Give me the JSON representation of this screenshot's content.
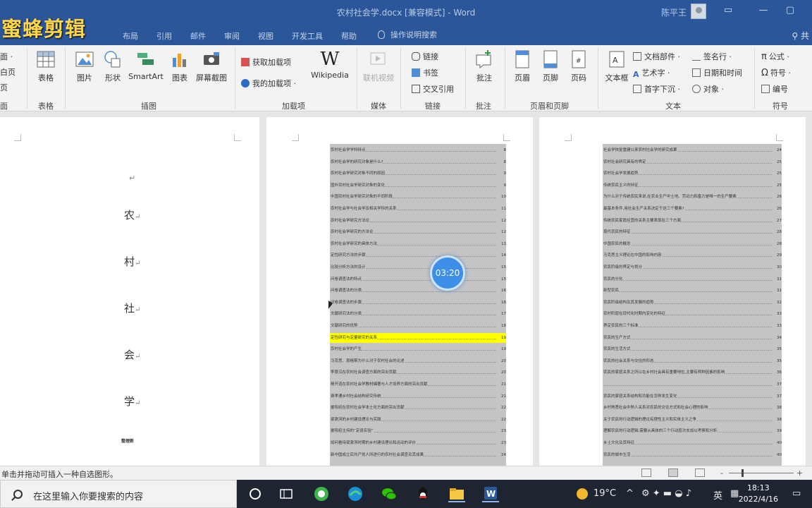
{
  "watermark": "蜜蜂剪辑",
  "titlebar": {
    "doc_title": "农村社会学.docx [兼容模式] - Word",
    "user_name": "陈平王"
  },
  "tabs": [
    "布局",
    "引用",
    "邮件",
    "审阅",
    "视图",
    "开发工具",
    "帮助"
  ],
  "tell_me": "操作说明搜索",
  "share": "共",
  "ribbon": {
    "left_partial": [
      "面 ·",
      "白页",
      "页",
      "面"
    ],
    "table": "表格",
    "illustrations": [
      "图片",
      "形状",
      "SmartArt",
      "图表",
      "屏幕截图"
    ],
    "addins": [
      "获取加载项",
      "我的加载项"
    ],
    "wikipedia": "Wikipedia",
    "media_btn": "联机视频",
    "links": [
      "链接",
      "书签",
      "交叉引用"
    ],
    "comment_btn": "批注",
    "header_footer": [
      "页眉",
      "页脚",
      "页码"
    ],
    "textbox": "文本框",
    "text_small": [
      "文档部件 ·",
      "艺术字 ·",
      "首字下沉 ·"
    ],
    "text_small2": [
      "签名行 ·",
      "日期和时间",
      "对象 ·"
    ],
    "symbols": [
      "公式 ·",
      "符号 ·",
      "编号"
    ],
    "groups": [
      "面",
      "表格",
      "插图",
      "加载项",
      "媒体",
      "链接",
      "批注",
      "页眉和页脚",
      "文本",
      "符号"
    ]
  },
  "cover": {
    "return_mark": "↵",
    "chars": [
      "农",
      "村",
      "社",
      "会",
      "学"
    ],
    "para_mark": "↵",
    "subtitle": "整理新"
  },
  "toc_page2": [
    {
      "t": "农村社会学学科特点",
      "p": "8"
    },
    {
      "t": "农村社会学的研究对象是什么?",
      "p": "8"
    },
    {
      "t": "农村社会学研究对象不同的原因",
      "p": "9"
    },
    {
      "t": "国外农村社会学研究对象的变化",
      "p": "9"
    },
    {
      "t": "中国农村社会学研究对象的不同阶段",
      "p": "10"
    },
    {
      "t": "农村社会学与社会学及相关学科的关系",
      "p": "11"
    },
    {
      "t": "农村社会学研究方法论",
      "p": "12"
    },
    {
      "t": "农村社会学研究的方法论",
      "p": "12"
    },
    {
      "t": "农村社会学研究的具体方法",
      "p": "13"
    },
    {
      "t": "定性研究方法的步骤",
      "p": "14"
    },
    {
      "t": "比较分析方法的设计",
      "p": "15"
    },
    {
      "t": "问卷调查法的特点",
      "p": "15"
    },
    {
      "t": "问卷调查法的分类",
      "p": "16"
    },
    {
      "t": "问卷调查法的步骤",
      "p": "16"
    },
    {
      "t": "文献研究法的分类",
      "p": "17"
    },
    {
      "t": "文献研究的优势",
      "p": "18"
    },
    {
      "t": "定性研究与定量研究的关系",
      "p": "19",
      "hl": true
    },
    {
      "t": "农村社会学的产生",
      "p": "19"
    },
    {
      "t": "马克思、恩格斯为什么对于农村社会的论述",
      "p": "20"
    },
    {
      "t": "李景汉在农村社会调查方面的突出贡献",
      "p": "20"
    },
    {
      "t": "杨开道在农村社会学教材编著与人才培养方面的突出贡献",
      "p": "21"
    },
    {
      "t": "费孝通乡村社会结构研究传统",
      "p": "21"
    },
    {
      "t": "晏阳初在农村社会学本土化方面的突出贡献",
      "p": "22"
    },
    {
      "t": "梁漱溟的乡村建设理论与实践",
      "p": "22"
    },
    {
      "t": "晏阳初主持的“定县实验”",
      "p": "23"
    },
    {
      "t": "如何看待梁漱溟时期的乡村建设理论和运动的评价",
      "p": "23"
    },
    {
      "t": "新中国成立后共产党人所进行的农村社会调查及其成果",
      "p": "24"
    }
  ],
  "toc_page3": [
    {
      "t": "社会学恢复重建以来农村社会学的研究成果",
      "p": "24"
    },
    {
      "t": "农村社会研究具有的界定",
      "p": "25"
    },
    {
      "t": "农村社会学发展趋势",
      "p": "25"
    },
    {
      "t": "传统农民主义的特征",
      "p": "25"
    },
    {
      "t": "为什么对于传统农民来说,在农业生产中土地、劳动力和畜力是唯一的生产要素",
      "p": "26"
    },
    {
      "t": "最基本条件,用社会生产关系决定于这三个要素?",
      "p": "26"
    },
    {
      "t": "传统农民家庭经营的关系主要表现在三个方面",
      "p": "27"
    },
    {
      "t": "现代农民的特征",
      "p": "28"
    },
    {
      "t": "中国农民的概念",
      "p": "28"
    },
    {
      "t": "马克思主义理论在中国的影响内容",
      "p": "29"
    },
    {
      "t": "农民阶级的界定与划分",
      "p": "30"
    },
    {
      "t": "农民的分化",
      "p": "31"
    },
    {
      "t": "新型农民",
      "p": "31"
    },
    {
      "t": "农民阶级结构及其发展的趋势",
      "p": "32"
    },
    {
      "t": "农村阶层在现代化时期内变化的特征",
      "p": "33"
    },
    {
      "t": "界定农民的三个标准",
      "p": "33"
    },
    {
      "t": "农民的生产方式",
      "p": "34"
    },
    {
      "t": "农民的生活方式",
      "p": "35"
    },
    {
      "t": "农民的社会关系与交往的形态",
      "p": "35"
    },
    {
      "t": "农民的家庭关系之所以在乡村社会具有重要地位,主要有两种因素的影响",
      "p": "36"
    },
    {
      "t": "",
      "p": "37"
    },
    {
      "t": "农民的家庭关系结构和功能在怎样发生变化",
      "p": "37"
    },
    {
      "t": "乡村熟悉社会中熟人关系对农民的交往方式和社会心理的影响",
      "p": "38"
    },
    {
      "t": "关于农民的行动逻辑的理论有理性主义和实体主义之争",
      "p": "38"
    },
    {
      "t": "理解农民的行动逻辑,需要从具体的三个行动层次去加以考察和分析",
      "p": "39"
    },
    {
      "t": "乡土文化及其特征",
      "p": "40"
    },
    {
      "t": "农民的城市生活",
      "p": "40"
    }
  ],
  "timer": "03:20",
  "statusbar": {
    "text": "单击并拖动可插入一种自选图形。",
    "zoom_minus": "-",
    "zoom_plus": "+"
  },
  "taskbar": {
    "search_placeholder": "在这里输入你要搜索的内容",
    "weather": "19°C",
    "ime": "英",
    "time": "18:13",
    "date": "2022/4/16"
  }
}
